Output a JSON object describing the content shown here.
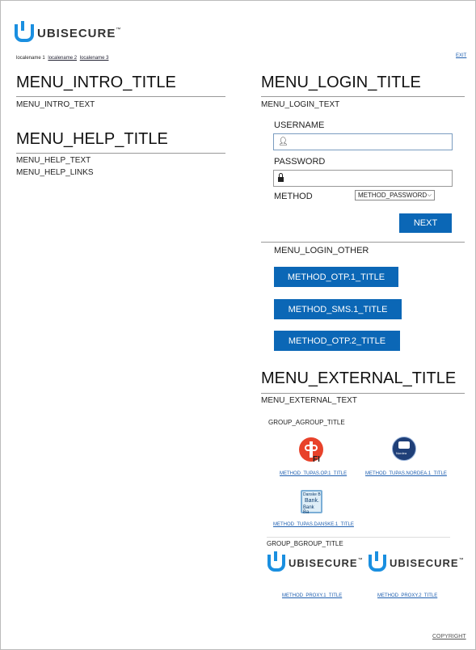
{
  "brand": {
    "name": "UBISECURE",
    "tm": "™"
  },
  "locales": {
    "current": "localename 1",
    "links": [
      "localename 2",
      "localename 3"
    ]
  },
  "exit": "EXIT",
  "intro": {
    "title": "MENU_INTRO_TITLE",
    "text": "MENU_INTRO_TEXT"
  },
  "help": {
    "title": "MENU_HELP_TITLE",
    "text": "MENU_HELP_TEXT",
    "links": "MENU_HELP_LINKS"
  },
  "login": {
    "title": "MENU_LOGIN_TITLE",
    "text": "MENU_LOGIN_TEXT",
    "username_label": "USERNAME",
    "username_value": "",
    "password_label": "PASSWORD",
    "password_value": "",
    "method_label": "METHOD",
    "method_value": "METHOD_PASSWORD",
    "next": "NEXT",
    "other_title": "MENU_LOGIN_OTHER",
    "other_methods": [
      "METHOD_OTP.1_TITLE",
      "METHOD_SMS.1_TITLE",
      "METHOD_OTP.2_TITLE"
    ]
  },
  "external": {
    "title": "MENU_EXTERNAL_TITLE",
    "text": "MENU_EXTERNAL_TEXT",
    "group_a": "GROUP_AGROUP_TITLE",
    "op_label": "FI",
    "nordea_logo_text": "Nordea",
    "danske_logo_text": [
      "Danske B",
      "Bank.",
      "Bank Ba"
    ],
    "links_a": [
      "METHOD_TUPAS.OP.1_TITLE",
      "METHOD_TUPAS.NORDEA.1_TITLE",
      "METHOD_TUPAS.DANSKE.1_TITLE"
    ],
    "group_b": "GROUP_BGROUP_TITLE",
    "links_b": [
      "METHOD_PROXY.1_TITLE",
      "METHOD_PROXY.2_TITLE"
    ]
  },
  "copyright": "COPYRIGHT",
  "colors": {
    "accent": "#0b67b6",
    "brand": "#1a8fe0",
    "op_red": "#e8422a"
  }
}
